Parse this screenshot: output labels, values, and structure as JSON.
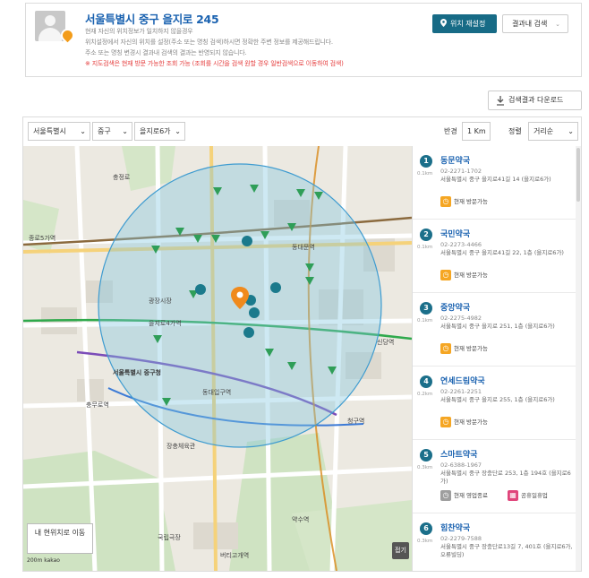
{
  "location": {
    "title": "서울특별시 중구 을지로 245",
    "desc_lines": [
      "현재 자신의 위치정보가 일치하지 않을경우",
      "위치설정에서 자신의 위치를 설정(주소 또는 명칭 검색)하시면 정확한 주변 정보를 제공해드립니다.",
      "주소 또는 명칭 변경시 결과내 검색의 결과는 반영되지 않습니다."
    ],
    "warning": "※ 지도검색은 현재 방문 가능한 조회 가능 (조회를 시간을 검색 원할 경우 일반검색으로 이동하여 검색)",
    "reset_button": "위치 재설정",
    "result_search_button": "결과내 검색"
  },
  "download_button": "검색결과 다운로드",
  "filters": {
    "city": "서울특별시",
    "district": "중구",
    "dong": "을지로6가",
    "radius_label": "반경",
    "radius_value": "1 Km",
    "sort_label": "정렬",
    "sort_value": "거리순"
  },
  "map": {
    "my_location_button": "내 현위치로 이동",
    "scale_text": "200m",
    "provider": "kakao",
    "fold_button": "접기",
    "place_labels": [
      {
        "text": "종로5가역"
      },
      {
        "text": "동대문역"
      },
      {
        "text": "을지로4가역"
      },
      {
        "text": "서울특별시 중구청"
      },
      {
        "text": "청구역"
      },
      {
        "text": "신당역"
      },
      {
        "text": "동대입구역"
      },
      {
        "text": "약수역"
      },
      {
        "text": "버티고개역"
      },
      {
        "text": "충무로역"
      },
      {
        "text": "국립극장"
      },
      {
        "text": "장충체육관"
      },
      {
        "text": "광장시장"
      },
      {
        "text": "충정로"
      }
    ]
  },
  "pharmacies": [
    {
      "num": "1",
      "distance": "0.1km",
      "name": "동문약국",
      "phone": "02-2271-1702",
      "address": "서울특별시 중구 을지로41길 14 (을지로6가)",
      "status": "현재 방문가능",
      "status_kind": "open"
    },
    {
      "num": "2",
      "distance": "0.1km",
      "name": "국민약국",
      "phone": "02-2273-4466",
      "address": "서울특별시 중구 을지로41길 22, 1층 (을지로6가)",
      "status": "현재 방문가능",
      "status_kind": "open"
    },
    {
      "num": "3",
      "distance": "0.1km",
      "name": "중앙약국",
      "phone": "02-2275-4982",
      "address": "서울특별시 중구 을지로 251, 1층 (을지로6가)",
      "status": "현재 방문가능",
      "status_kind": "open"
    },
    {
      "num": "4",
      "distance": "0.2km",
      "name": "연세드림약국",
      "phone": "02-2261-2251",
      "address": "서울특별시 중구 을지로 255, 1층 (을지로6가)",
      "status": "현재 방문가능",
      "status_kind": "open"
    },
    {
      "num": "5",
      "distance": "0.3km",
      "name": "스마트약국",
      "phone": "02-6388-1967",
      "address": "서울특별시 중구 장충단로 253, 1층 194호 (을지로6가)",
      "status": "현재 영업종료",
      "status_kind": "closed",
      "status2": "공휴일휴업"
    },
    {
      "num": "6",
      "distance": "0.3km",
      "name": "힘찬약국",
      "phone": "02-2279-7588",
      "address": "서울특별시 중구 장충단로13길 7, 401호 (을지로6가, 오류빌딩)",
      "status": "",
      "status_kind": "none"
    }
  ]
}
